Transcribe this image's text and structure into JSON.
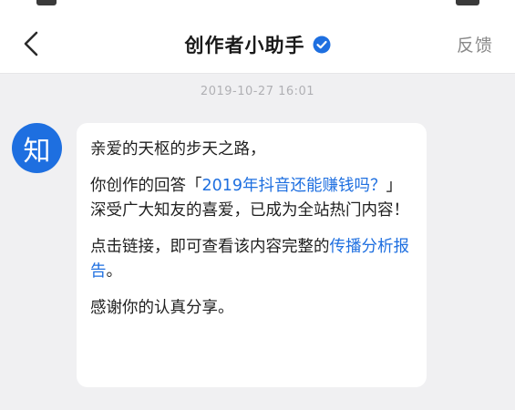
{
  "header": {
    "title": "创作者小助手",
    "verified_icon": "verified-check-icon",
    "back_icon": "chevron-left-icon",
    "feedback_label": "反馈"
  },
  "timestamp": "2019-10-27 16:01",
  "avatar": {
    "glyph": "知",
    "color": "#1e6fe0"
  },
  "message": {
    "greeting": "亲爱的天枢的步天之路，",
    "p2_before": "你创作的回答「",
    "p2_link": "2019年抖音还能赚钱吗？",
    "p2_after": "」深受广大知友的喜爱，已成为全站热门内容！",
    "p3_before": "点击链接，即可查看该内容完整的",
    "p3_link": "传播分析报告",
    "p3_after": "。",
    "closing": "感谢你的认真分享。"
  },
  "colors": {
    "accent": "#1e6fe0",
    "background": "#f0f0f2"
  }
}
